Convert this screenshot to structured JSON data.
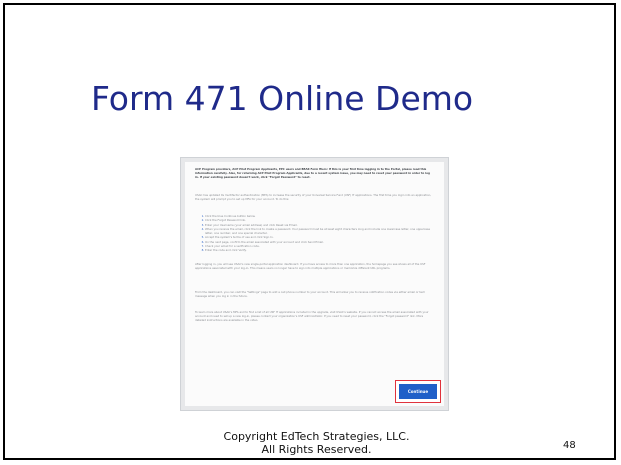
{
  "slide": {
    "title": "Form 471 Online Demo",
    "copyright_line1": "Copyright EdTech Strategies, LLC.",
    "copyright_line2": "All Rights Reserved.",
    "page_number": "48"
  },
  "screenshot": {
    "intro": "ACP Program providers, ACP Pilot Program Applicants, EPC users and BEAR Form filers: If this is your first time logging in to the Portal, please read this information carefully. Also, for returning ACP Pilot Program Applicants, due to a recent system issue, you may need to reset your password in order to log in. If your existing password doesn't work, click \"Forgot Password\" to reset.",
    "para2": "USAC has updated its multifactor authentication (MFA) to increase the security of your Universal Service Fund (USF) IT applications. The first time you login into an application, the system will prompt you to set up MFA for your account. To do this:",
    "steps": [
      "Click the blue Continue button below.",
      "Click the Forgot Password link.",
      "Enter your Username (your email address) and click Reset via Email.",
      "When you receive the email, click the link to create a password. Your password must be at least eight characters long and include one lowercase letter, one uppercase letter, one number, and one special character.",
      "Accept the system's terms of use and click Sign In.",
      "On the next page, confirm the email associated with your account and click Send Email.",
      "Check your email for a verification code.",
      "Enter the code and click Verify."
    ],
    "para3": "After logging in, you will see USAC's new single-portal application dashboard. If you have access to more than one application, the homepage you see shows all of the USF applications associated with your log-in. This means users no longer have to sign into multiple applications or memorize different URL programs.",
    "para4": "From the dashboard, you can visit the \"Settings\" page to add a cell phone number to your account. This will allow you to receive notification codes via either email or text message when you log in in the future.",
    "para5": "To learn more about USAC's MFA and to find a list of all USF IT applications included in the upgrade, visit USAC's website. If you cannot access the email associated with your account and need to set up a new log-in, please contact your organization's USF administrator. If you need to reset your password, click the \"Forgot password\" link. More detailed instructions are available in the video.",
    "continue_label": "Continue"
  }
}
